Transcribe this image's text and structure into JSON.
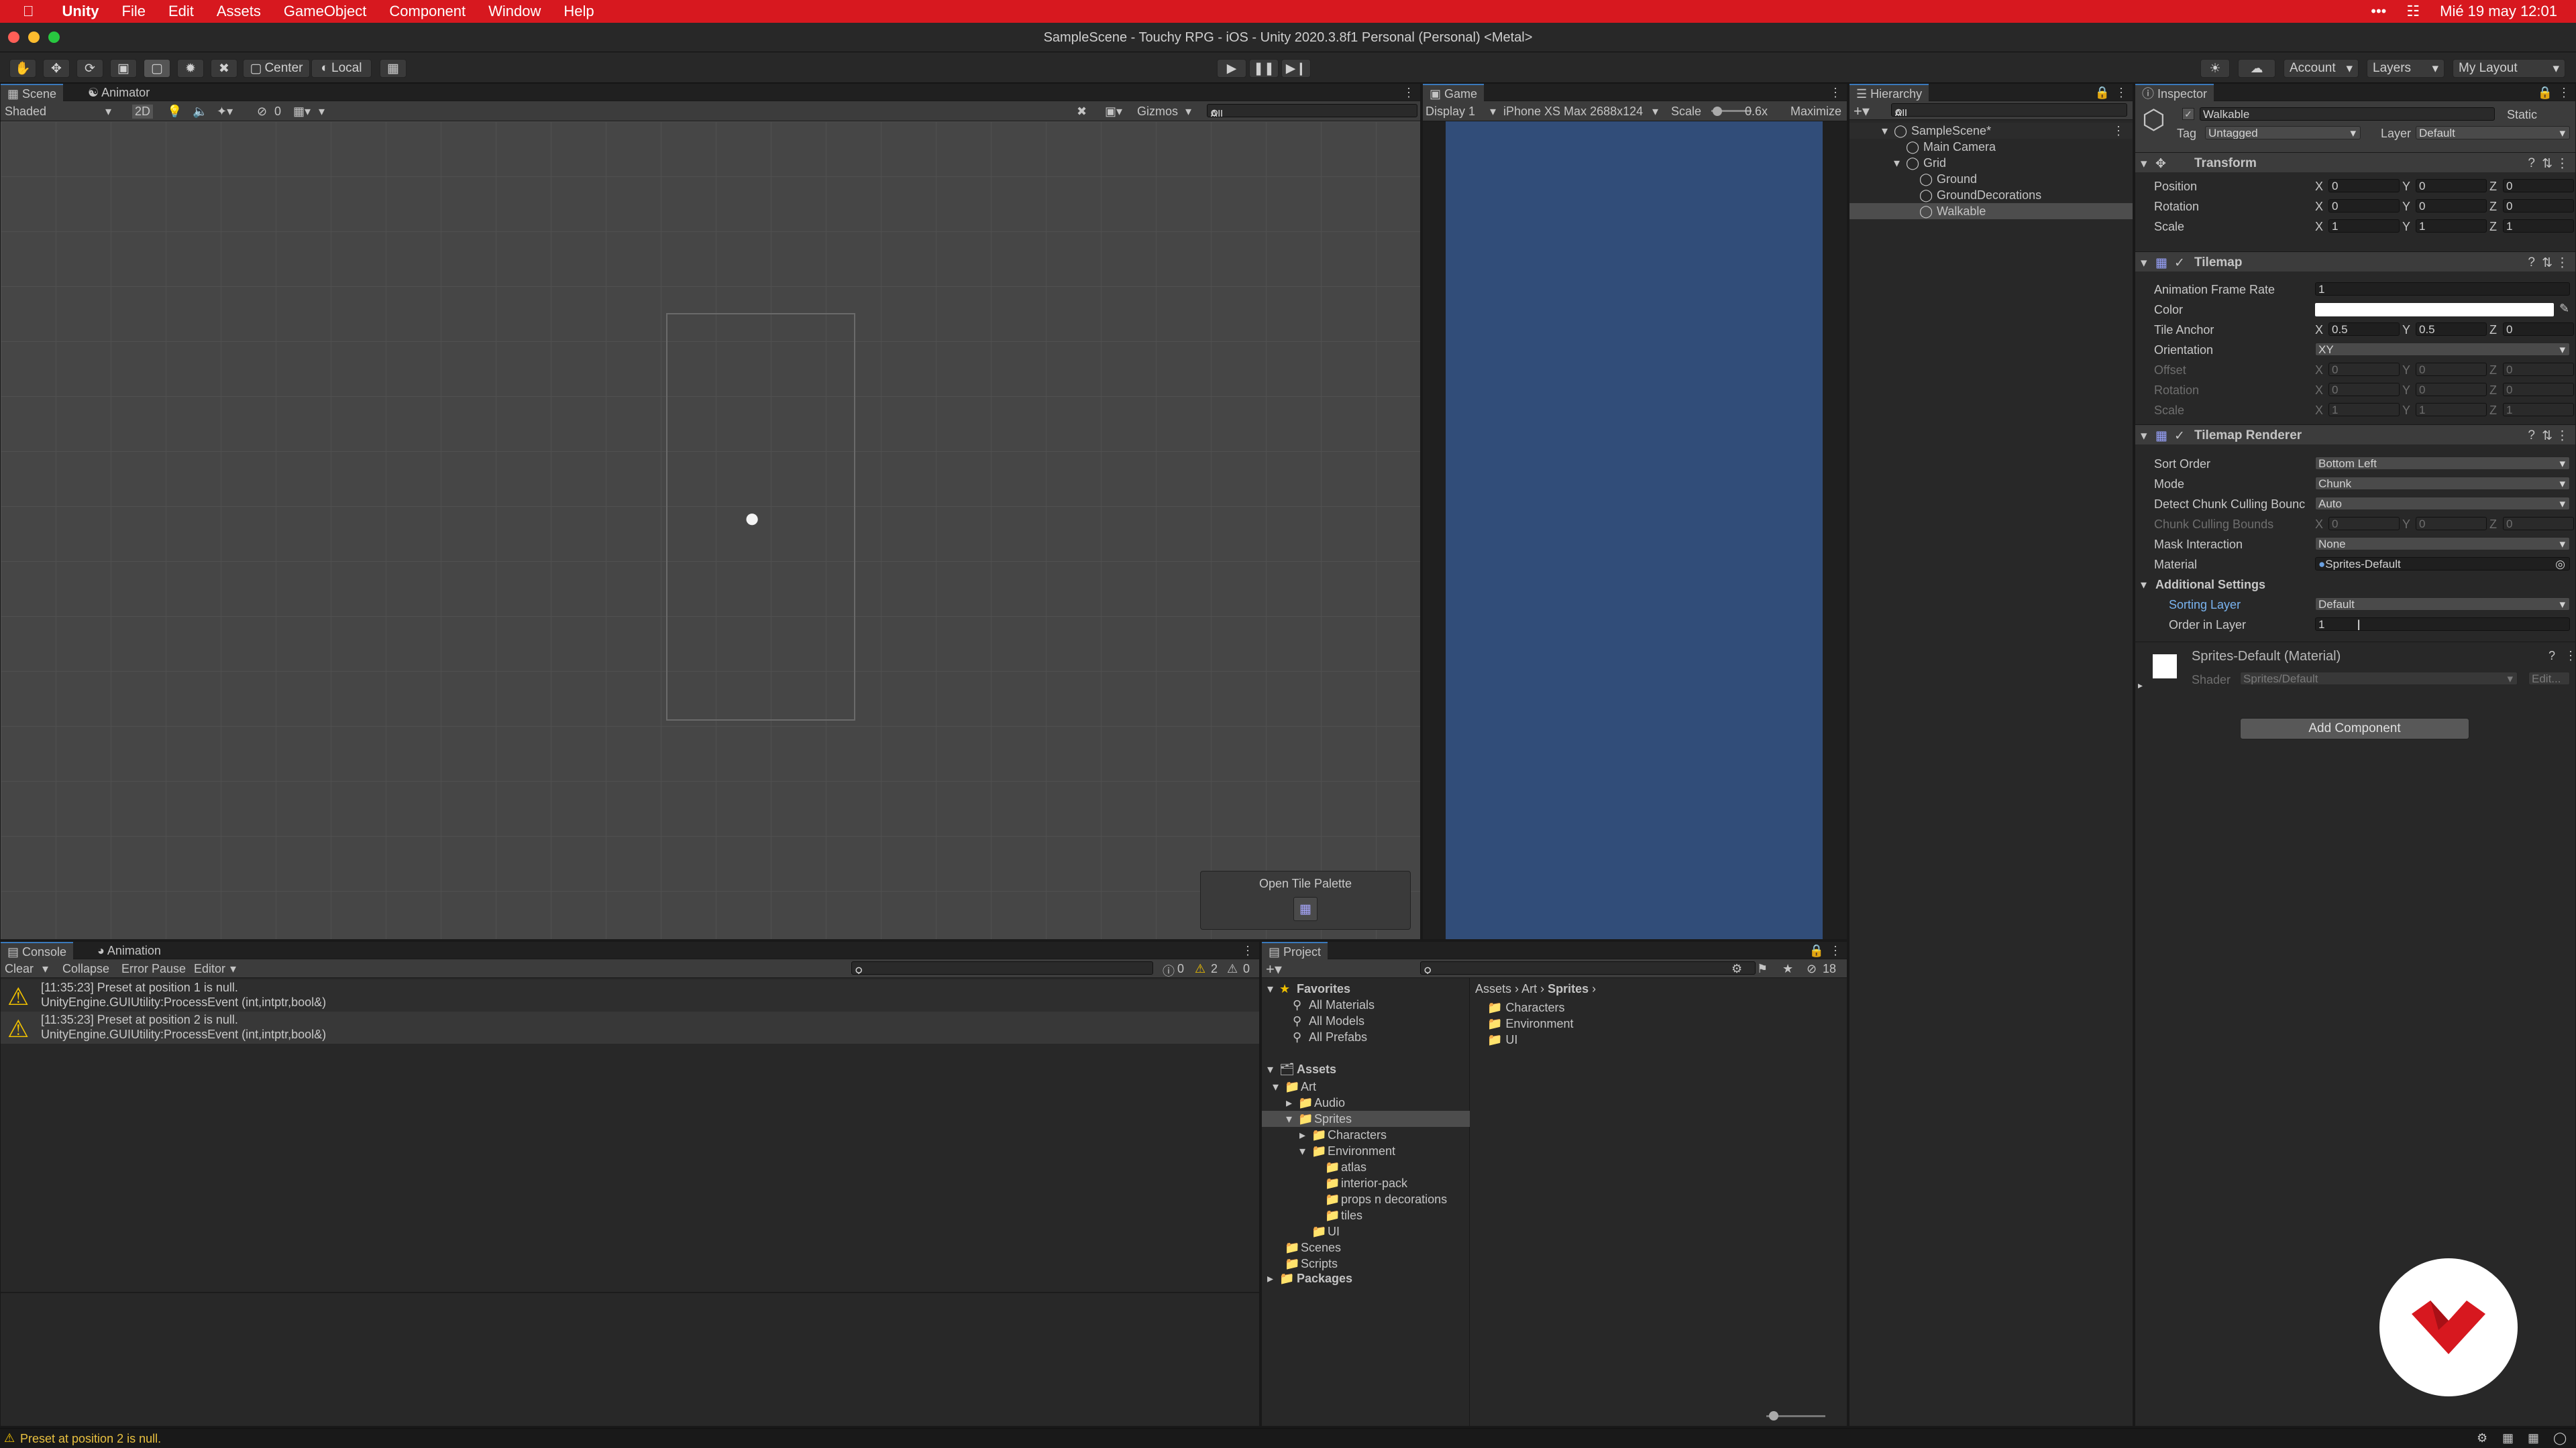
{
  "menubar": {
    "app": "Unity",
    "items": [
      "File",
      "Edit",
      "Assets",
      "GameObject",
      "Component",
      "Window",
      "Help"
    ],
    "more": "•••",
    "datetime": "Mié 19 may  12:01"
  },
  "window": {
    "title": "SampleScene - Touchy RPG - iOS - Unity 2020.3.8f1 Personal (Personal) <Metal>"
  },
  "toolbar": {
    "center": "Center",
    "local": "Local",
    "account": "Account",
    "layers": "Layers",
    "layout": "My Layout"
  },
  "scene": {
    "tabs": [
      "Scene",
      "Animator"
    ],
    "shading": "Shaded",
    "mode2d": "2D",
    "fx_count": "0",
    "gizmos": "Gizmos",
    "search": "All",
    "overlay_title": "Open Tile Palette"
  },
  "game": {
    "tab": "Game",
    "display": "Display 1",
    "resolution": "iPhone XS Max 2688x124",
    "scale_label": "Scale",
    "scale_value": "0.6x",
    "maximize": "Maximize"
  },
  "hierarchy": {
    "tab": "Hierarchy",
    "search": "All",
    "scene": "SampleScene*",
    "items": [
      "Main Camera",
      "Grid",
      "Ground",
      "GroundDecorations",
      "Walkable"
    ]
  },
  "inspector": {
    "tab": "Inspector",
    "object_name": "Walkable",
    "static": "Static",
    "tag_label": "Tag",
    "tag_value": "Untagged",
    "layer_label": "Layer",
    "layer_value": "Default",
    "transform": {
      "title": "Transform",
      "rows": [
        {
          "label": "Position",
          "x": "0",
          "y": "0",
          "z": "0"
        },
        {
          "label": "Rotation",
          "x": "0",
          "y": "0",
          "z": "0"
        },
        {
          "label": "Scale",
          "x": "1",
          "y": "1",
          "z": "1"
        }
      ]
    },
    "tilemap": {
      "title": "Tilemap",
      "frame_rate_label": "Animation Frame Rate",
      "frame_rate": "1",
      "color_label": "Color",
      "anchor_label": "Tile Anchor",
      "anchor": {
        "x": "0.5",
        "y": "0.5",
        "z": "0"
      },
      "orientation_label": "Orientation",
      "orientation": "XY",
      "dim_rows": [
        {
          "label": "Offset",
          "x": "0",
          "y": "0",
          "z": "0"
        },
        {
          "label": "Rotation",
          "x": "0",
          "y": "0",
          "z": "0"
        },
        {
          "label": "Scale",
          "x": "1",
          "y": "1",
          "z": "1"
        }
      ]
    },
    "renderer": {
      "title": "Tilemap Renderer",
      "sort_order_label": "Sort Order",
      "sort_order": "Bottom Left",
      "mode_label": "Mode",
      "mode": "Chunk",
      "detect_label": "Detect Chunk Culling Bounc",
      "detect": "Auto",
      "bounds_label": "Chunk Culling Bounds",
      "bounds": {
        "x": "0",
        "y": "0",
        "z": "0"
      },
      "mask_label": "Mask Interaction",
      "mask": "None",
      "material_label": "Material",
      "material": "Sprites-Default",
      "additional": "Additional Settings",
      "sorting_layer_label": "Sorting Layer",
      "sorting_layer": "Default",
      "order_label": "Order in Layer",
      "order": "1"
    },
    "material": {
      "name": "Sprites-Default (Material)",
      "shader_label": "Shader",
      "shader": "Sprites/Default",
      "edit": "Edit..."
    },
    "add_component": "Add Component"
  },
  "console": {
    "tabs": [
      "Console",
      "Animation"
    ],
    "buttons": [
      "Clear",
      "Collapse",
      "Error Pause",
      "Editor"
    ],
    "counts": {
      "info": "0",
      "warn": "2",
      "error": "0"
    },
    "entries": [
      {
        "line1": "[11:35:23] Preset at position 1 is null.",
        "line2": "UnityEngine.GUIUtility:ProcessEvent (int,intptr,bool&)"
      },
      {
        "line1": "[11:35:23] Preset at position 2 is null.",
        "line2": "UnityEngine.GUIUtility:ProcessEvent (int,intptr,bool&)"
      }
    ]
  },
  "project": {
    "tab": "Project",
    "hidden_count": "18",
    "favorites": "Favorites",
    "favorite_items": [
      "All Materials",
      "All Models",
      "All Prefabs"
    ],
    "assets": "Assets",
    "tree": [
      "Art",
      "Audio",
      "Sprites",
      "Characters",
      "Environment",
      "atlas",
      "interior-pack",
      "props n decorations",
      "tiles",
      "UI",
      "Scenes",
      "Scripts"
    ],
    "packages": "Packages",
    "breadcrumb": [
      "Assets",
      "Art",
      "Sprites"
    ],
    "folders": [
      "Characters",
      "Environment",
      "UI"
    ]
  },
  "status": {
    "message": "Preset at position 2 is null."
  }
}
